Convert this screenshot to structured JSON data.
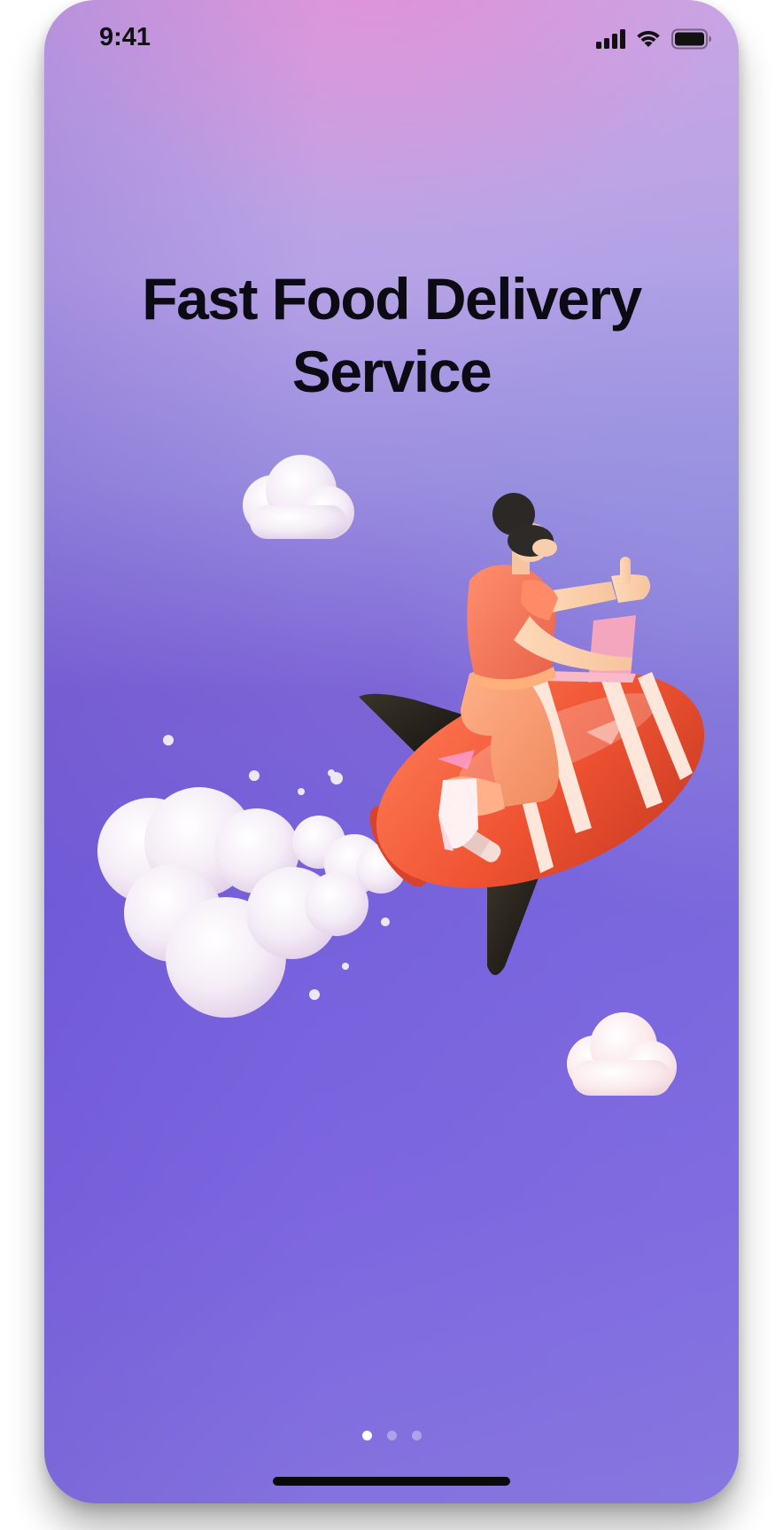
{
  "status_bar": {
    "time": "9:41",
    "icons": [
      "cellular-signal-icon",
      "wifi-icon",
      "battery-icon"
    ]
  },
  "onboarding": {
    "title_line1": "Fast Food Delivery",
    "title_line2": "Service",
    "illustration": "woman-riding-rocket-illustration",
    "page_indicator": {
      "total_pages": 3,
      "current_page": 1
    }
  },
  "colors": {
    "background_top": "#d594d8",
    "background_mid": "#7c64d6",
    "background_bottom": "#8472de",
    "title": "#0c0a12",
    "rocket": "#ee5a36"
  }
}
